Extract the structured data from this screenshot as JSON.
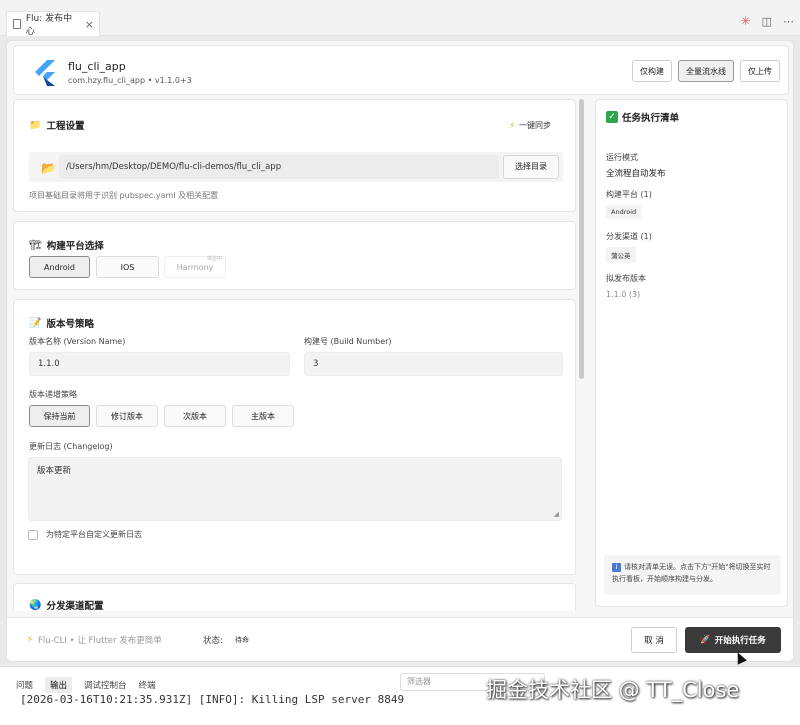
{
  "tab": {
    "title": "Flu: 发布中心",
    "close": "×"
  },
  "app": {
    "name": "flu_cli_app",
    "meta": "com.hzy.flu_cli_app • v1.1.0+3"
  },
  "mode_buttons": [
    "仅构建",
    "全量流水线",
    "仅上传"
  ],
  "project": {
    "title": "工程设置",
    "sync": "一键同步",
    "path": "/Users/hm/Desktop/DEMO/flu-cli-demos/flu_cli_app",
    "choose": "选择目录",
    "hint": "项目基础目录将用于识别 pubspec.yaml 及相关配置"
  },
  "platform": {
    "title": "构建平台选择",
    "options": [
      "Android",
      "IOS",
      "Harmony"
    ],
    "harmony_badge": "体验中"
  },
  "version": {
    "title": "版本号策略",
    "name_label": "版本名称 (Version Name)",
    "name_value": "1.1.0",
    "build_label": "构建号 (Build Number)",
    "build_value": "3",
    "strategy_label": "版本递增策略",
    "strategies": [
      "保持当前",
      "修订版本",
      "次版本",
      "主版本"
    ],
    "changelog_label": "更新日志 (Changelog)",
    "changelog_value": "版本更新",
    "custom_label": "为特定平台自定义更新日志"
  },
  "distribution": {
    "title": "分发渠道配置"
  },
  "tasks": {
    "title": "任务执行清单",
    "mode_label": "运行模式",
    "mode_value": "全流程自动发布",
    "platform_label": "构建平台 (1)",
    "platform_chip": "Android",
    "channel_label": "分发渠道 (1)",
    "channel_chip": "蒲公英",
    "version_label": "拟发布版本",
    "version_value": "1.1.0 (3)",
    "notice": "请核对清单无误。点击下方\"开始\"将切换至实时执行看板，开始顺序构建与分发。"
  },
  "footer": {
    "brand": "Flu-CLI • 让 Flutter 发布更简单",
    "status_label": "状态:",
    "status_value": "待命",
    "cancel": "取 消",
    "start": "开始执行任务"
  },
  "bottom_panel": {
    "tabs": [
      "问题",
      "输出",
      "调试控制台",
      "终端"
    ],
    "filter_placeholder": "筛选器",
    "log": "[2026-03-16T10:21:35.931Z] [INFO]: Killing LSP server 8849"
  },
  "watermark": "掘金技术社区 @ TT_Close",
  "colors": {
    "accent": "#2ea44f",
    "primary_button": "#3a3a3a",
    "flutter_blue": "#42a5f5"
  }
}
